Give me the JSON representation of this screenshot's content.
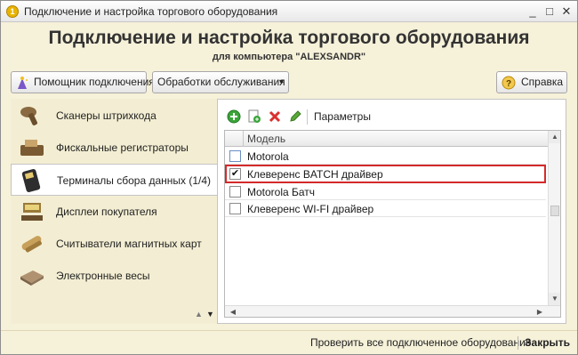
{
  "window": {
    "title": "Подключение и настройка торгового оборудования",
    "minimize": "_",
    "maximize": "□",
    "close": "✕"
  },
  "header": {
    "title": "Подключение и настройка торгового оборудования",
    "subtitle": "для компьютера \"ALEXSANDR\""
  },
  "toolbar": {
    "wizard_label": "Помощник подключения",
    "service_label": "Обработки обслуживания",
    "service_arrow": "▾",
    "help_label": "Справка"
  },
  "nav": {
    "items": [
      {
        "label": "Сканеры штрихкода",
        "icon": "barcode-scanner-icon"
      },
      {
        "label": "Фискальные регистраторы",
        "icon": "fiscal-printer-icon"
      },
      {
        "label": "Терминалы сбора данных (1/4)",
        "icon": "data-terminal-icon",
        "active": true
      },
      {
        "label": "Дисплеи покупателя",
        "icon": "customer-display-icon"
      },
      {
        "label": "Считыватели магнитных карт",
        "icon": "card-reader-icon"
      },
      {
        "label": "Электронные весы",
        "icon": "scales-icon"
      }
    ],
    "up_arrow": "▲",
    "down_arrow": "▼"
  },
  "panel": {
    "params_label": "Параметры",
    "column_model": "Модель",
    "rows": [
      {
        "checked": false,
        "model": "Motorola"
      },
      {
        "checked": true,
        "model": "Клеверенс BATCH драйвер",
        "highlighted": true
      },
      {
        "checked": false,
        "model": "Motorola Батч"
      },
      {
        "checked": false,
        "model": "Клеверенс WI-FI драйвер"
      }
    ],
    "check_mark": "✔",
    "scroll_up": "▲",
    "scroll_down": "▼",
    "scroll_left": "◀",
    "scroll_right": "▶"
  },
  "footer": {
    "check_all_label": "Проверить все подключенное оборудование",
    "close_label": "Закрыть"
  },
  "colors": {
    "background": "#f6f1d9",
    "highlight": "#d42a2a",
    "add_green": "#3aa53a",
    "delete_red": "#d93030"
  }
}
